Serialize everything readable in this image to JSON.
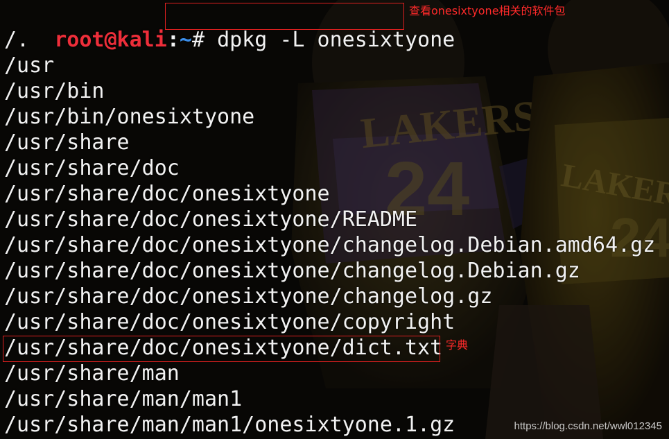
{
  "prompt": {
    "user_host": "root@kali",
    "colon": ":",
    "path": "~",
    "symbol": "#",
    "command": "dpkg -L onesixtyone"
  },
  "output_lines": [
    "/.",
    "/usr",
    "/usr/bin",
    "/usr/bin/onesixtyone",
    "/usr/share",
    "/usr/share/doc",
    "/usr/share/doc/onesixtyone",
    "/usr/share/doc/onesixtyone/README",
    "/usr/share/doc/onesixtyone/changelog.Debian.amd64.gz",
    "/usr/share/doc/onesixtyone/changelog.Debian.gz",
    "/usr/share/doc/onesixtyone/changelog.gz",
    "/usr/share/doc/onesixtyone/copyright",
    "/usr/share/doc/onesixtyone/dict.txt",
    "/usr/share/man",
    "/usr/share/man/man1",
    "/usr/share/man/man1/onesixtyone.1.gz"
  ],
  "annotations": {
    "command_note": "查看onesixtyone相关的软件包",
    "dict_note": "字典"
  },
  "background": {
    "left_jersey_text": "LAKERS",
    "left_jersey_number": "24",
    "right_jersey_text": "LAKERS",
    "right_jersey_number": "24"
  },
  "watermark": "https://blog.csdn.net/wwl012345",
  "colors": {
    "prompt_user": "#ee2e3a",
    "prompt_path": "#3b8eea",
    "text": "#f2f2f2",
    "annotation": "#ff2a2a"
  }
}
